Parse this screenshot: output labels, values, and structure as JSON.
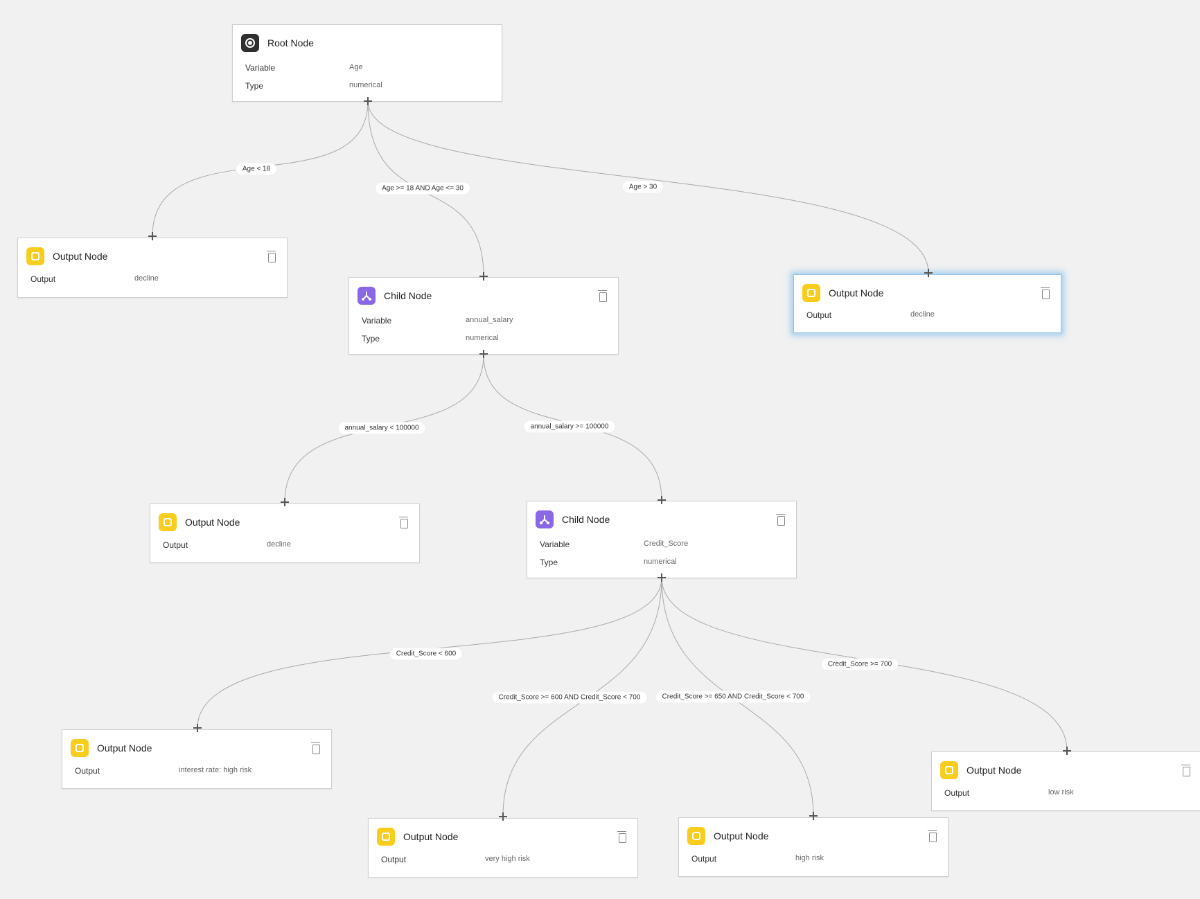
{
  "nodes": {
    "root": {
      "title": "Root Node",
      "variable_label": "Variable",
      "variable_value": "Age",
      "type_label": "Type",
      "type_value": "numerical"
    },
    "out1": {
      "title": "Output Node",
      "output_label": "Output",
      "output_value": "decline"
    },
    "child1": {
      "title": "Child Node",
      "variable_label": "Variable",
      "variable_value": "annual_salary",
      "type_label": "Type",
      "type_value": "numerical"
    },
    "out2": {
      "title": "Output Node",
      "output_label": "Output",
      "output_value": "decline"
    },
    "out3": {
      "title": "Output Node",
      "output_label": "Output",
      "output_value": "decline"
    },
    "child2": {
      "title": "Child Node",
      "variable_label": "Variable",
      "variable_value": "Credit_Score",
      "type_label": "Type",
      "type_value": "numerical"
    },
    "out4": {
      "title": "Output Node",
      "output_label": "Output",
      "output_value": "interest rate: high risk"
    },
    "out5": {
      "title": "Output Node",
      "output_label": "Output",
      "output_value": "very high risk"
    },
    "out6": {
      "title": "Output Node",
      "output_label": "Output",
      "output_value": "high risk"
    },
    "out7": {
      "title": "Output Node",
      "output_label": "Output",
      "output_value": "low risk"
    }
  },
  "edges": {
    "e1": "Age < 18",
    "e2": "Age >= 18 AND Age <= 30",
    "e3": "Age > 30",
    "e4": "annual_salary < 100000",
    "e5": "annual_salary >= 100000",
    "e6": "Credit_Score < 600",
    "e7": "Credit_Score >= 600 AND Credit_Score < 700",
    "e8": "Credit_Score >= 650 AND Credit_Score < 700",
    "e9": "Credit_Score >= 700"
  },
  "icons": {
    "root": "target-icon",
    "child": "branch-icon",
    "output": "output-icon",
    "delete": "trash-icon",
    "handle": "plus-handle-icon"
  },
  "colors": {
    "root_icon": "#2f2f2f",
    "child_icon": "#8b67e6",
    "output_icon": "#f8cd1e",
    "selected_glow": "#8fc4ea"
  }
}
